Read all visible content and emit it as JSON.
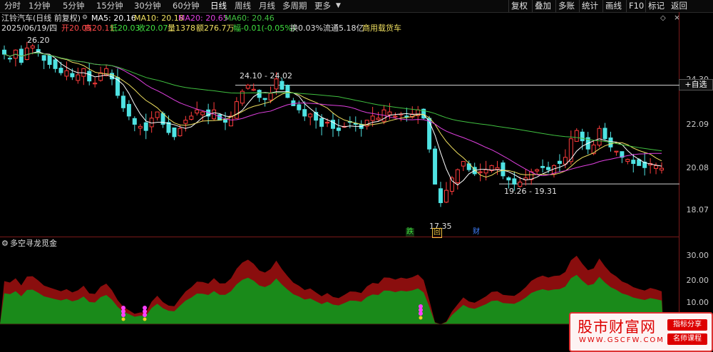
{
  "toolbar": {
    "periods": [
      "分时",
      "1分钟",
      "5分钟",
      "15分钟",
      "30分钟",
      "60分钟",
      "日线",
      "周线",
      "月线",
      "多周期",
      "更多"
    ],
    "active_period": "日线",
    "right_buttons": [
      "复权",
      "叠加",
      "多账",
      "统计",
      "画线",
      "F10",
      "标记",
      "+自选",
      "返回"
    ]
  },
  "stock": {
    "title": "江铃汽车(日线 前复权)",
    "ma5": "MA5: 20.16",
    "ma10": "MA10: 20.18",
    "ma20": "MA20: 20.65",
    "ma60": "MA60: 20.46",
    "date": "2025/06/19/四",
    "open": "开20.05",
    "high": "高20.11",
    "low": "低20.03",
    "close": "收20.07",
    "volume": "量1378",
    "amount": "额276.7万",
    "change": "幅-0.01(-0.05%)",
    "turnover": "换0.03%",
    "float": "流通5.18亿",
    "concept": "商用载货车"
  },
  "annotations": {
    "high_top": "26.20",
    "range_upper": "24.10 - 24.02",
    "range_lower": "19.26 - 19.31",
    "low_point": "17.35",
    "badge_die": "跌",
    "badge_hui": "回",
    "badge_cai": "财"
  },
  "price_axis": [
    "24.30",
    "22.09",
    "20.08",
    "18.07"
  ],
  "indicator": {
    "name": "多空寻龙觅金",
    "axis": [
      "30.00",
      "20.00",
      "10.00"
    ]
  },
  "watermark": {
    "title": "股市财富网",
    "url": "WWW.GSCFW.COM",
    "tag1": "指标分享",
    "tag2": "名师课程"
  },
  "colors": {
    "up": "#ff3c3c",
    "down": "#4fe3e3",
    "ma5": "#ffffff",
    "ma10": "#f0e060",
    "ma20": "#e040e0",
    "ma60": "#40c040",
    "ind_red": "#8a0e0e",
    "ind_green": "#1a8a1a"
  },
  "chart_data": {
    "type": "candlestick",
    "price_range": [
      17.0,
      26.5
    ],
    "closes": [
      25.6,
      25.4,
      25.8,
      25.2,
      25.9,
      26.0,
      25.7,
      25.3,
      25.1,
      24.9,
      24.7,
      24.8,
      24.5,
      24.6,
      24.9,
      24.3,
      24.2,
      24.7,
      24.9,
      24.4,
      23.6,
      23.0,
      22.6,
      22.2,
      22.1,
      21.9,
      22.5,
      22.8,
      22.2,
      21.8,
      21.6,
      22.0,
      22.4,
      22.6,
      22.9,
      22.8,
      22.6,
      22.9,
      22.4,
      22.3,
      22.6,
      23.3,
      23.8,
      24.1,
      23.9,
      23.5,
      23.4,
      23.7,
      24.4,
      23.9,
      23.5,
      23.1,
      22.9,
      22.6,
      22.7,
      22.4,
      22.1,
      22.3,
      22.0,
      21.9,
      22.1,
      22.3,
      22.2,
      22.0,
      22.4,
      22.6,
      22.5,
      22.9,
      22.8,
      22.6,
      22.7,
      22.6,
      22.7,
      22.9,
      22.5,
      21.0,
      19.3,
      18.4,
      19.0,
      19.6,
      20.0,
      20.4,
      20.0,
      19.8,
      19.9,
      20.0,
      20.2,
      20.1,
      19.7,
      19.5,
      19.3,
      19.4,
      19.6,
      19.9,
      20.0,
      20.1,
      20.0,
      20.2,
      20.3,
      20.6,
      21.5,
      21.9,
      21.4,
      21.0,
      21.2,
      22.0,
      21.5,
      21.1,
      20.9,
      20.6,
      20.5,
      20.3,
      20.2,
      20.1,
      20.3,
      20.2,
      20.07
    ]
  }
}
